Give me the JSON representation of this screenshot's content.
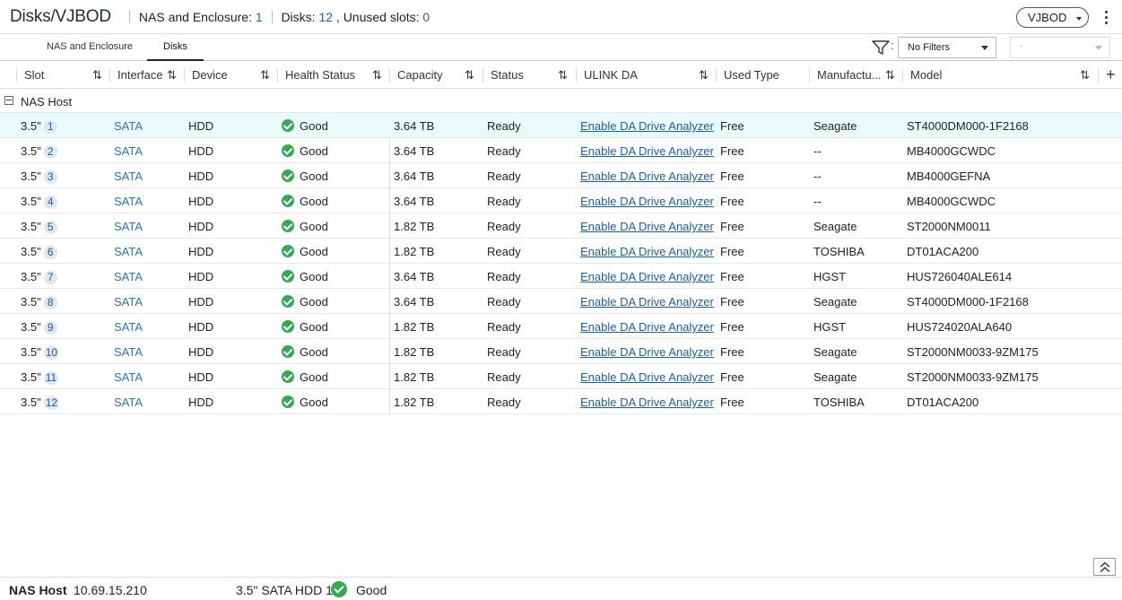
{
  "header": {
    "title": "Disks/VJBOD",
    "nas_label": "NAS and Enclosure:",
    "nas_count": "1",
    "disks_label": "Disks:",
    "disks_count": "12",
    "unused_label": ", Unused slots:",
    "unused_count": "0",
    "enclosure_select": "VJBOD"
  },
  "tabs": [
    {
      "label": "NAS and Enclosure",
      "active": false
    },
    {
      "label": "Disks",
      "active": true
    }
  ],
  "filter": {
    "colon": ":",
    "selected": "No Filters",
    "value": "-"
  },
  "columns": [
    "Slot",
    "Interface",
    "Device",
    "Health Status",
    "Capacity",
    "Status",
    "ULINK DA",
    "Used Type",
    "Manufactu...",
    "Model"
  ],
  "group": {
    "label": "NAS Host"
  },
  "rows": [
    {
      "slot_size": "3.5\"",
      "slot_num": "1",
      "interface": "SATA",
      "device": "HDD",
      "health": "Good",
      "capacity": "3.64 TB",
      "status": "Ready",
      "ulink": "Enable DA Drive Analyzer",
      "used_type": "Free",
      "manufacturer": "Seagate",
      "model": "ST4000DM000-1F2168"
    },
    {
      "slot_size": "3.5\"",
      "slot_num": "2",
      "interface": "SATA",
      "device": "HDD",
      "health": "Good",
      "capacity": "3.64 TB",
      "status": "Ready",
      "ulink": "Enable DA Drive Analyzer",
      "used_type": "Free",
      "manufacturer": "--",
      "model": "MB4000GCWDC"
    },
    {
      "slot_size": "3.5\"",
      "slot_num": "3",
      "interface": "SATA",
      "device": "HDD",
      "health": "Good",
      "capacity": "3.64 TB",
      "status": "Ready",
      "ulink": "Enable DA Drive Analyzer",
      "used_type": "Free",
      "manufacturer": "--",
      "model": "MB4000GEFNA"
    },
    {
      "slot_size": "3.5\"",
      "slot_num": "4",
      "interface": "SATA",
      "device": "HDD",
      "health": "Good",
      "capacity": "3.64 TB",
      "status": "Ready",
      "ulink": "Enable DA Drive Analyzer",
      "used_type": "Free",
      "manufacturer": "--",
      "model": "MB4000GCWDC"
    },
    {
      "slot_size": "3.5\"",
      "slot_num": "5",
      "interface": "SATA",
      "device": "HDD",
      "health": "Good",
      "capacity": "1.82 TB",
      "status": "Ready",
      "ulink": "Enable DA Drive Analyzer",
      "used_type": "Free",
      "manufacturer": "Seagate",
      "model": "ST2000NM0011"
    },
    {
      "slot_size": "3.5\"",
      "slot_num": "6",
      "interface": "SATA",
      "device": "HDD",
      "health": "Good",
      "capacity": "1.82 TB",
      "status": "Ready",
      "ulink": "Enable DA Drive Analyzer",
      "used_type": "Free",
      "manufacturer": "TOSHIBA",
      "model": "DT01ACA200"
    },
    {
      "slot_size": "3.5\"",
      "slot_num": "7",
      "interface": "SATA",
      "device": "HDD",
      "health": "Good",
      "capacity": "3.64 TB",
      "status": "Ready",
      "ulink": "Enable DA Drive Analyzer",
      "used_type": "Free",
      "manufacturer": "HGST",
      "model": "HUS726040ALE614"
    },
    {
      "slot_size": "3.5\"",
      "slot_num": "8",
      "interface": "SATA",
      "device": "HDD",
      "health": "Good",
      "capacity": "3.64 TB",
      "status": "Ready",
      "ulink": "Enable DA Drive Analyzer",
      "used_type": "Free",
      "manufacturer": "Seagate",
      "model": "ST4000DM000-1F2168"
    },
    {
      "slot_size": "3.5\"",
      "slot_num": "9",
      "interface": "SATA",
      "device": "HDD",
      "health": "Good",
      "capacity": "1.82 TB",
      "status": "Ready",
      "ulink": "Enable DA Drive Analyzer",
      "used_type": "Free",
      "manufacturer": "HGST",
      "model": "HUS724020ALA640"
    },
    {
      "slot_size": "3.5\"",
      "slot_num": "10",
      "interface": "SATA",
      "device": "HDD",
      "health": "Good",
      "capacity": "1.82 TB",
      "status": "Ready",
      "ulink": "Enable DA Drive Analyzer",
      "used_type": "Free",
      "manufacturer": "Seagate",
      "model": "ST2000NM0033-9ZM175"
    },
    {
      "slot_size": "3.5\"",
      "slot_num": "11",
      "interface": "SATA",
      "device": "HDD",
      "health": "Good",
      "capacity": "1.82 TB",
      "status": "Ready",
      "ulink": "Enable DA Drive Analyzer",
      "used_type": "Free",
      "manufacturer": "Seagate",
      "model": "ST2000NM0033-9ZM175"
    },
    {
      "slot_size": "3.5\"",
      "slot_num": "12",
      "interface": "SATA",
      "device": "HDD",
      "health": "Good",
      "capacity": "1.82 TB",
      "status": "Ready",
      "ulink": "Enable DA Drive Analyzer",
      "used_type": "Free",
      "manufacturer": "TOSHIBA",
      "model": "DT01ACA200"
    }
  ],
  "footer": {
    "host_label": "NAS Host",
    "ip": "10.69.15.210",
    "disk": "3.5\" SATA HDD 1",
    "health": "Good"
  },
  "colors": {
    "accent": "#1b5fa8",
    "good": "#35a853",
    "selected_row": "#e9fbfb"
  }
}
